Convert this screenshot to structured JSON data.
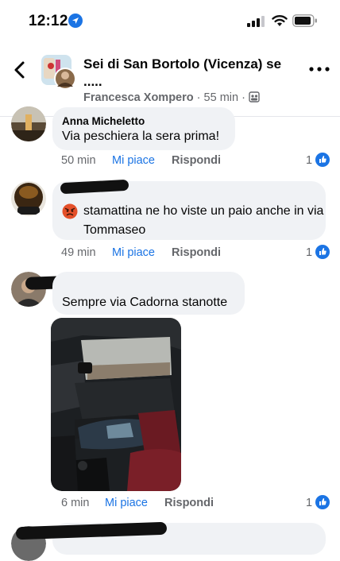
{
  "status_bar": {
    "time": "12:12"
  },
  "header": {
    "title": "Sei di San Bortolo (Vicenza) se .....",
    "author": "Francesca Xompero",
    "separator": "·",
    "time": "55 min",
    "separator2": "·"
  },
  "comments": [
    {
      "author": "Anna Micheletto",
      "text": "Via peschiera la sera prima!",
      "time": "50 min",
      "like_label": "Mi piace",
      "reply_label": "Rispondi",
      "likes": "1"
    },
    {
      "author": "",
      "text": "stamattina ne ho viste un paio anche in via Tommaseo",
      "time": "49 min",
      "like_label": "Mi piace",
      "reply_label": "Rispondi",
      "likes": "1"
    },
    {
      "author": "",
      "text": "Sempre via Cadorna stanotte",
      "time": "6 min",
      "like_label": "Mi piace",
      "reply_label": "Rispondi",
      "likes": "1"
    }
  ],
  "colors": {
    "accent": "#1b74e4",
    "bubble": "#f0f2f5",
    "meta": "#65676b"
  }
}
